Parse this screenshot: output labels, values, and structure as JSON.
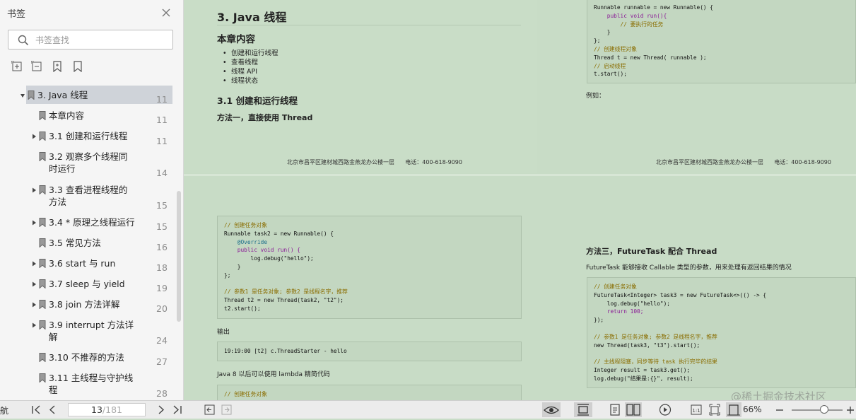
{
  "sidebar": {
    "title": "书签",
    "search_placeholder": "书签查找",
    "bookmarks": [
      {
        "label": "3. Java 线程",
        "page": "11"
      },
      {
        "label": "本章内容",
        "page": "11"
      },
      {
        "label": "3.1 创建和运行线程",
        "page": "11"
      },
      {
        "label": "3.2 观察多个线程同\n时运行",
        "page": "14"
      },
      {
        "label": "3.3 查看进程线程的\n方法",
        "page": "15"
      },
      {
        "label": "3.4 * 原理之线程运行",
        "page": "15"
      },
      {
        "label": "3.5 常见方法",
        "page": "16"
      },
      {
        "label": "3.6 start 与 run",
        "page": "18"
      },
      {
        "label": "3.7 sleep 与 yield",
        "page": "19"
      },
      {
        "label": "3.8 join 方法详解",
        "page": "20"
      },
      {
        "label": "3.9 interrupt 方法详\n解",
        "page": "24"
      },
      {
        "label": "3.10 不推荐的方法",
        "page": "27"
      },
      {
        "label": "3.11 主线程与守护线\n程",
        "page": "28"
      }
    ]
  },
  "document": {
    "heading": "3. Java 线程",
    "section": "本章内容",
    "list": [
      "创建和运行线程",
      "查看线程",
      "线程 API",
      "线程状态"
    ],
    "sub1": "3.1 创建和运行线程",
    "method1": "方法一，直接使用 Thread",
    "footer": "北京市昌平区建材城西路金燕龙办公楼一层      电话：400-618-9090",
    "output_label": "输出",
    "output_line": "19:19:00 [t2] c.ThreadStarter - hello",
    "lambda_text": "Java 8 以后可以使用 lambda 精简代码",
    "lambda_code": "// 创建任务对象",
    "example_label": "例如：",
    "method3": "方法三，FutureTask 配合 Thread",
    "futuretask_text": "FutureTask 能够接收 Callable 类型的参数，用来处理有返回结果的情况",
    "code_runnable_top": [
      "Runnable runnable = new Runnable() {",
      "    public void run(){",
      "        // 要执行的任务",
      "    }",
      "};",
      "// 创建线程对象",
      "Thread t = new Thread( runnable );",
      "// 启动线程",
      "t.start();"
    ],
    "code_task2": [
      "// 创建任务对象",
      "Runnable task2 = new Runnable() {",
      "    @Override",
      "    public void run() {",
      "        log.debug(\"hello\");",
      "    }",
      "};",
      "",
      "// 参数1 是任务对象; 参数2 是线程名字，推荐",
      "Thread t2 = new Thread(task2, \"t2\");",
      "t2.start();"
    ],
    "code_task3": [
      "// 创建任务对象",
      "FutureTask<Integer> task3 = new FutureTask<>(() -> {",
      "    log.debug(\"hello\");",
      "    return 100;",
      "});",
      "",
      "// 参数1 是任务对象; 参数2 是线程名字，推荐",
      "new Thread(task3, \"t3\").start();",
      "",
      "// 主线程阻塞，同步等待 task 执行完毕的结果",
      "Integer result = task3.get();",
      "log.debug(\"结果是:{}\", result);"
    ]
  },
  "bottombar": {
    "nav_label": "航",
    "current_page": "13",
    "total_pages": "/181",
    "zoom": "66%"
  },
  "watermark": "@稀土掘金技术社区"
}
